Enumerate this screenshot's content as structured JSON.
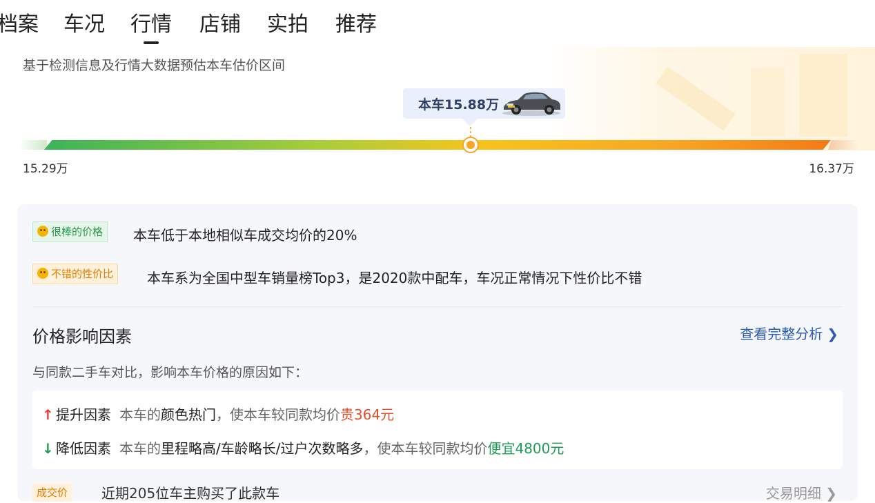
{
  "tabs": [
    {
      "label": "档案"
    },
    {
      "label": "车况"
    },
    {
      "label": "行情",
      "active": true
    },
    {
      "label": "店铺"
    },
    {
      "label": "实拍"
    },
    {
      "label": "推荐"
    }
  ],
  "estimate": {
    "subtitle": "基于检测信息及行情大数据预估本车估价区间",
    "current_price_label": "本车15.88万",
    "min_label": "15.29万",
    "max_label": "16.37万",
    "min_value": 15.29,
    "max_value": 16.37,
    "current_value": 15.88,
    "bar_colors": [
      "#3cb35a",
      "#a8cd3a",
      "#f5c51c",
      "#f7a623",
      "#f47b16"
    ]
  },
  "highlights": [
    {
      "tag": "很棒的价格",
      "text": "本车低于本地相似车成交均价的20%",
      "color": "#2a9a4a"
    },
    {
      "tag": "不错的性价比",
      "text": "本车系为全国中型车销量榜Top3，是2020款中配车，车况正常情况下性价比不错",
      "color": "#e57c00"
    }
  ],
  "factors_section": {
    "title": "价格影响因素",
    "link": "查看完整分析",
    "link_chevron": "❯",
    "description": "与同款二手车对比，影响本车价格的原因如下：",
    "up": {
      "label": "提升因素",
      "prefix": "本车的",
      "highlight": "颜色热门",
      "middle": "，使本车较同款均价",
      "result": "贵364元"
    },
    "down": {
      "label": "降低因素",
      "prefix": "本车的",
      "highlight": "里程略高/车龄略长/过户次数略多",
      "middle": "，使本车较同款均价",
      "result": "便宜4800元"
    }
  },
  "bottom": {
    "tag": "成交价",
    "text": "近期205位车主购买了此款车",
    "link": "交易明细 ❯"
  }
}
